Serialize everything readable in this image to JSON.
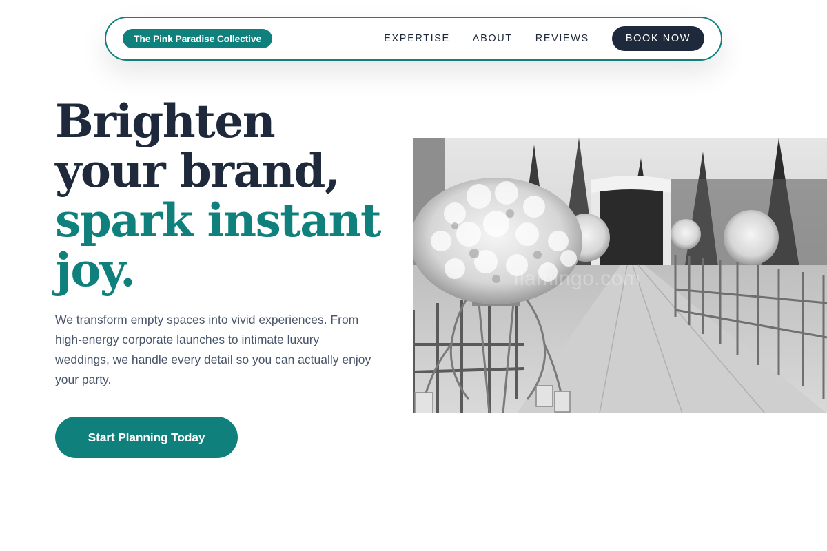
{
  "nav": {
    "brand": "The Pink Paradise Collective",
    "links": [
      "EXPERTISE",
      "ABOUT",
      "REVIEWS"
    ],
    "cta": "BOOK NOW"
  },
  "hero": {
    "title_lines": [
      "Brighten",
      "your brand,"
    ],
    "title_accent_lines": [
      "spark instant",
      "joy."
    ],
    "description": "We transform empty spaces into vivid experiences. From high-energy corporate launches to intimate luxury weddings, we handle every detail so you can actually enjoy your party.",
    "cta": "Start Planning Today",
    "image": {
      "subject": "wedding aisle with floral arrangements",
      "watermark": "flamingo.com"
    }
  },
  "colors": {
    "accent": "#0f807c",
    "dark": "#1e293b",
    "body_text": "#475569",
    "background": "#ffffff"
  }
}
